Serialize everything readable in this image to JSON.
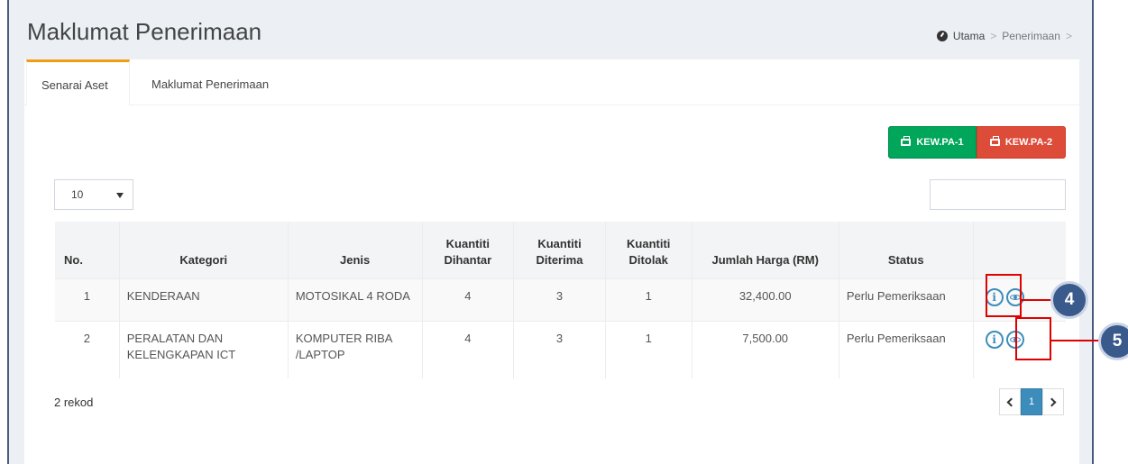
{
  "header": {
    "title": "Maklumat Penerimaan",
    "breadcrumb": {
      "home": "Utama",
      "current": "Penerimaan",
      "sep": ">"
    }
  },
  "tabs": [
    {
      "label": "Senarai Aset",
      "active": true
    },
    {
      "label": "Maklumat Penerimaan",
      "active": false
    }
  ],
  "actions": {
    "kew_pa1": "KEW.PA-1",
    "kew_pa2": "KEW.PA-2"
  },
  "page_size": "10",
  "table": {
    "headers": {
      "no": "No.",
      "kategori": "Kategori",
      "jenis": "Jenis",
      "dihantar": [
        "Kuantiti",
        "Dihantar"
      ],
      "diterima": [
        "Kuantiti",
        "Diterima"
      ],
      "ditolak": [
        "Kuantiti",
        "Ditolak"
      ],
      "harga": "Jumlah Harga (RM)",
      "status": "Status"
    },
    "rows": [
      {
        "no": "1",
        "kategori": [
          "KENDERAAN"
        ],
        "jenis": [
          "MOTOSIKAL 4 RODA"
        ],
        "dihantar": "4",
        "diterima": "3",
        "ditolak": "1",
        "harga": "32,400.00",
        "status": "Perlu Pemeriksaan"
      },
      {
        "no": "2",
        "kategori": [
          "PERALATAN DAN",
          "KELENGKAPAN ICT"
        ],
        "jenis": [
          "KOMPUTER RIBA",
          "/LAPTOP"
        ],
        "dihantar": "4",
        "diterima": "3",
        "ditolak": "1",
        "harga": "7,500.00",
        "status": "Perlu Pemeriksaan"
      }
    ]
  },
  "footer": {
    "record_count": "2 rekod",
    "current_page": "1"
  },
  "callouts": {
    "c4": "4",
    "c5": "5"
  },
  "colors": {
    "accent": "#3c8dbc",
    "tab_active": "#f39c12",
    "green": "#00a65a",
    "red": "#dd4b39",
    "highlight": "#e00000",
    "callout": "#3a5a8c"
  },
  "icons": [
    "dashboard-icon",
    "printer-icon",
    "info-icon",
    "eye-icon",
    "chevron-left-icon",
    "chevron-right-icon"
  ]
}
